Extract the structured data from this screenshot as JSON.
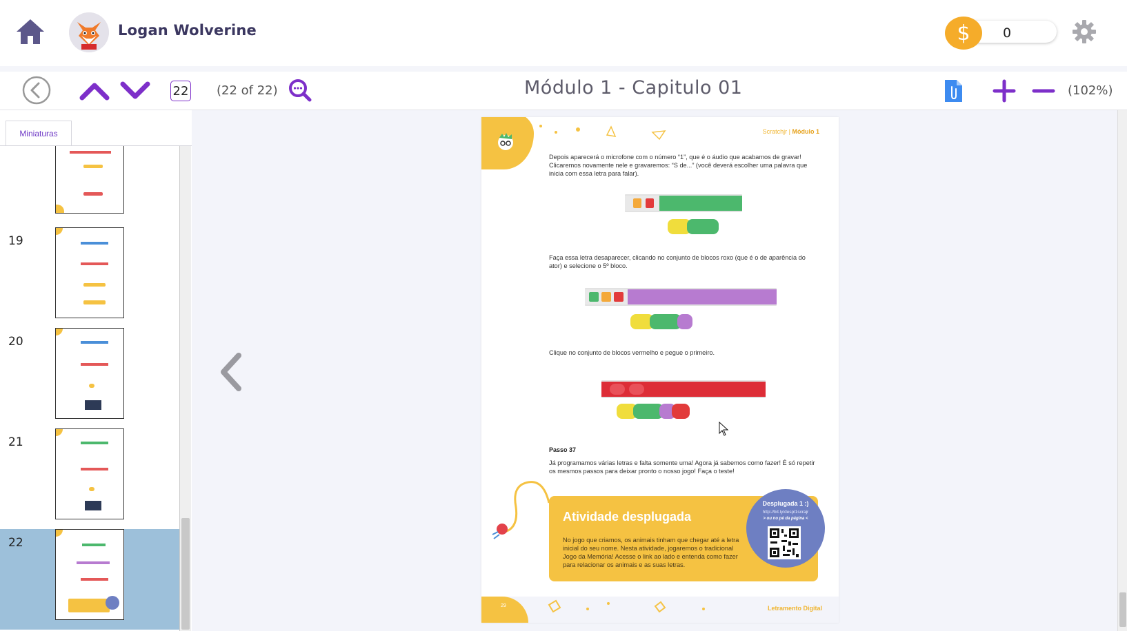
{
  "header": {
    "home_icon": "home-icon",
    "user_name": "Logan Wolverine",
    "avatar_icon": "fox-avatar",
    "coin_symbol": "$",
    "coin_value": "0",
    "settings_icon": "gear-icon"
  },
  "toolbar": {
    "back_icon": "circle-back-icon",
    "prev_icon": "chevron-up-icon",
    "next_icon": "chevron-down-icon",
    "current_page": "22",
    "page_count": "(22 of 22)",
    "search_icon": "search-icon",
    "title": "Módulo 1 - Capitulo 01",
    "attach_icon": "attachment-icon",
    "zoom_in_icon": "plus-icon",
    "zoom_out_icon": "minus-icon",
    "zoom": "(102%)",
    "accent": "#7d2fc9"
  },
  "sidebar": {
    "tab_label": "Miniaturas",
    "thumbnails": [
      {
        "number": ""
      },
      {
        "number": "19"
      },
      {
        "number": "20"
      },
      {
        "number": "21"
      },
      {
        "number": "22",
        "active": true
      }
    ]
  },
  "page": {
    "header_text": "Scratchjr |",
    "header_bold": "Módulo 1",
    "para1": "Depois aparecerá o microfone com o número “1”, que é o áudio que acabamos de gravar! Clicaremos novamente nele e gravaremos: “S de...” (você deverá escolher uma palavra que inicia com essa letra para falar).",
    "para2": "Faça essa letra desaparecer, clicando no conjunto de blocos roxo (que é o de aparência do ator) e selecione o 5º bloco.",
    "para3": "Clique no conjunto de blocos vermelho e pegue o primeiro.",
    "step_label": "Passo 37",
    "para4": "Já programamos várias letras e falta somente uma! Agora já sabemos como fazer! É só repetir os mesmos passos para deixar pronto o nosso jogo! Faça o teste!",
    "activity_title": "Atividade desplugada",
    "activity_text": "No jogo que criamos, os animais tinham que chegar até a letra inicial do seu nome. Nesta atividade, jogaremos o tradicional Jogo da Memória! Acesse o link ao lado e entenda como fazer para relacionar os animais e as suas letras.",
    "bubble_title": "Desplugada 1 :)",
    "bubble_link": "http://bit.ly/despl1scrajr",
    "bubble_sub": "> ou no pé da página <",
    "page_number": "29",
    "footer_text": "Letramento Digital"
  },
  "viewer": {
    "prev_page_icon": "chevron-left-icon"
  }
}
